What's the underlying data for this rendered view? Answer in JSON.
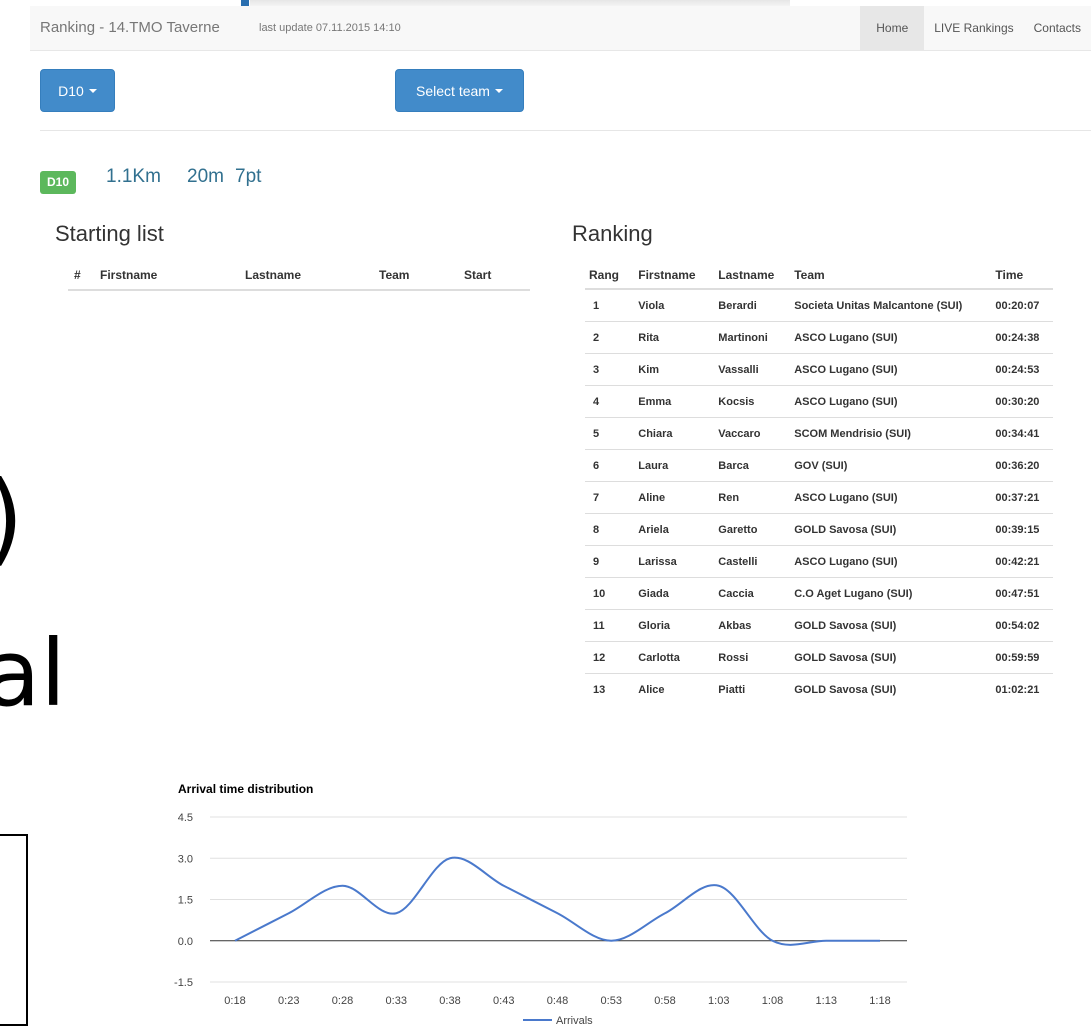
{
  "navbar": {
    "brand": "Ranking - 14.TMO Taverne",
    "last_update": "last update 07.11.2015 14:10",
    "links": [
      "Home",
      "LIVE Rankings",
      "Contacts"
    ],
    "active_link": "Home"
  },
  "controls": {
    "category_button": "D10",
    "team_button": "Select team"
  },
  "course": {
    "category": "D10",
    "distance": "1.1Km",
    "climb": "20m",
    "controls": "7pt"
  },
  "starting_list": {
    "title": "Starting list",
    "columns": [
      "#",
      "Firstname",
      "Lastname",
      "Team",
      "Start"
    ],
    "rows": []
  },
  "ranking": {
    "title": "Ranking",
    "columns": [
      "Rang",
      "Firstname",
      "Lastname",
      "Team",
      "Time"
    ],
    "rows": [
      [
        "1",
        "Viola",
        "Berardi",
        "Societa Unitas Malcantone (SUI)",
        "00:20:07"
      ],
      [
        "2",
        "Rita",
        "Martinoni",
        "ASCO Lugano (SUI)",
        "00:24:38"
      ],
      [
        "3",
        "Kim",
        "Vassalli",
        "ASCO Lugano (SUI)",
        "00:24:53"
      ],
      [
        "4",
        "Emma",
        "Kocsis",
        "ASCO Lugano (SUI)",
        "00:30:20"
      ],
      [
        "5",
        "Chiara",
        "Vaccaro",
        "SCOM Mendrisio (SUI)",
        "00:34:41"
      ],
      [
        "6",
        "Laura",
        "Barca",
        "GOV (SUI)",
        "00:36:20"
      ],
      [
        "7",
        "Aline",
        "Ren",
        "ASCO Lugano (SUI)",
        "00:37:21"
      ],
      [
        "8",
        "Ariela",
        "Garetto",
        "GOLD Savosa (SUI)",
        "00:39:15"
      ],
      [
        "9",
        "Larissa",
        "Castelli",
        "ASCO Lugano (SUI)",
        "00:42:21"
      ],
      [
        "10",
        "Giada",
        "Caccia",
        "C.O Aget Lugano (SUI)",
        "00:47:51"
      ],
      [
        "11",
        "Gloria",
        "Akbas",
        "GOLD Savosa (SUI)",
        "00:54:02"
      ],
      [
        "12",
        "Carlotta",
        "Rossi",
        "GOLD Savosa (SUI)",
        "00:59:59"
      ],
      [
        "13",
        "Alice",
        "Piatti",
        "GOLD Savosa (SUI)",
        "01:02:21"
      ]
    ]
  },
  "colors": {
    "primary_button": "#428bca",
    "badge": "#5cb85c",
    "course_text": "#31708f",
    "series_line": "#4a79cc"
  },
  "chart_data": {
    "type": "line",
    "title": "Arrival time distribution",
    "x": [
      "0:18",
      "0:23",
      "0:28",
      "0:33",
      "0:38",
      "0:43",
      "0:48",
      "0:53",
      "0:58",
      "1:03",
      "1:08",
      "1:13",
      "1:18"
    ],
    "series": [
      {
        "name": "Arrivals",
        "values": [
          0,
          1,
          2,
          1,
          3,
          2,
          1,
          0,
          1,
          2,
          0,
          0,
          0
        ]
      }
    ],
    "yticks": [
      "4.5",
      "3.0",
      "1.5",
      "0.0",
      "-1.5"
    ],
    "ylim": [
      -1.5,
      4.5
    ],
    "grid": true,
    "smooth": true,
    "legend": "bottom"
  }
}
